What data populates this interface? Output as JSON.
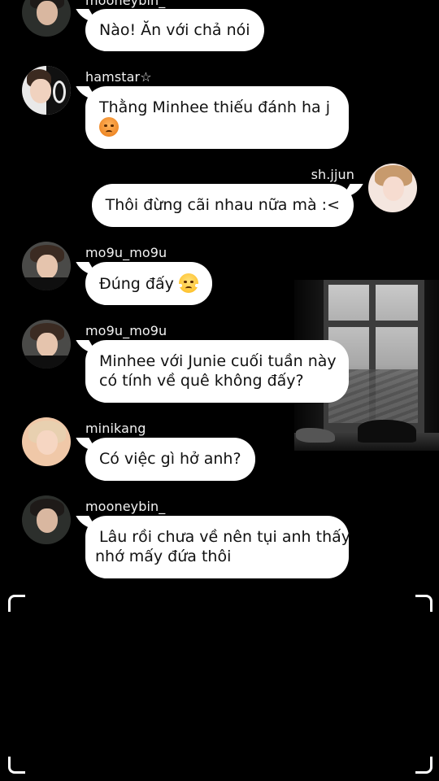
{
  "messages": [
    {
      "username": "mooneybin_",
      "text": "Nào! Ăn với chả nói",
      "side": "left",
      "emoji": ""
    },
    {
      "username": "hamstar☆",
      "text": "Thằng Minhee thiếu đánh ha j",
      "side": "left",
      "emoji": "angry-face"
    },
    {
      "username": "sh.jjun",
      "text": "Thôi đừng cãi nhau nữa mà :<",
      "side": "right",
      "emoji": ""
    },
    {
      "username": "mo9u_mo9u",
      "text": "Đúng đấy",
      "side": "left",
      "emoji": "face-with-steam"
    },
    {
      "username": "mo9u_mo9u",
      "text_lines": [
        "Minhee với Junie cuối tuần này",
        "có tính về quê không đấy?"
      ],
      "side": "left",
      "emoji": ""
    },
    {
      "username": "minikang",
      "text": "Có việc gì hở anh?",
      "side": "left",
      "emoji": ""
    },
    {
      "username": "mooneybin_",
      "text_lines": [
        "Lâu rồi chưa về nên tụi anh thấy",
        "nhớ mấy đứa thôi"
      ],
      "side": "left",
      "emoji": ""
    }
  ],
  "colors": {
    "background": "#000000",
    "bubble": "#ffffff",
    "username": "#f2f2f2",
    "text": "#111111"
  }
}
